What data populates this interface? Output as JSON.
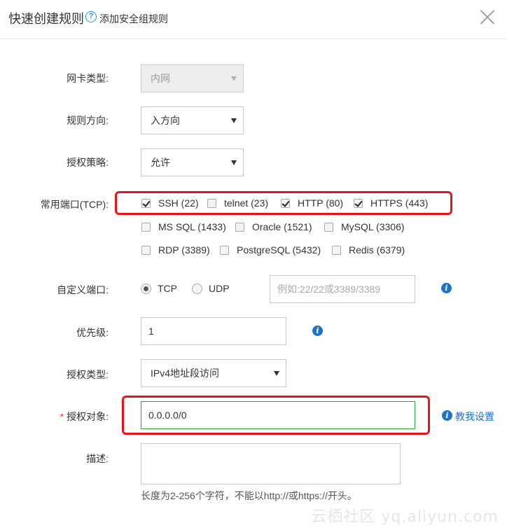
{
  "dialog": {
    "title": "快速创建规则",
    "help_icon": "?",
    "help_link": "添加安全组规则",
    "close_icon": "close-icon"
  },
  "form": {
    "nic_type": {
      "label": "网卡类型:",
      "value": "内网",
      "disabled": true
    },
    "direction": {
      "label": "规则方向:",
      "value": "入方向"
    },
    "policy": {
      "label": "授权策略:",
      "value": "允许"
    },
    "common_ports": {
      "label": "常用端口(TCP):",
      "options": [
        {
          "label": "SSH (22)",
          "checked": true
        },
        {
          "label": "telnet (23)",
          "checked": false
        },
        {
          "label": "HTTP (80)",
          "checked": true
        },
        {
          "label": "HTTPS (443)",
          "checked": true
        },
        {
          "label": "MS SQL (1433)",
          "checked": false
        },
        {
          "label": "Oracle (1521)",
          "checked": false
        },
        {
          "label": "MySQL (3306)",
          "checked": false
        },
        {
          "label": "RDP (3389)",
          "checked": false
        },
        {
          "label": "PostgreSQL (5432)",
          "checked": false
        },
        {
          "label": "Redis (6379)",
          "checked": false
        }
      ]
    },
    "custom_port": {
      "label": "自定义端口:",
      "protocols": [
        {
          "label": "TCP",
          "checked": true
        },
        {
          "label": "UDP",
          "checked": false
        }
      ],
      "value": "",
      "placeholder": "例如:22/22或3389/3389"
    },
    "priority": {
      "label": "优先级:",
      "value": "1"
    },
    "auth_type": {
      "label": "授权类型:",
      "value": "IPv4地址段访问"
    },
    "auth_object": {
      "label": "授权对象:",
      "required_mark": "*",
      "value": "0.0.0.0/0",
      "help_link": "教我设置"
    },
    "description": {
      "label": "描述:",
      "value": "",
      "hint": "长度为2-256个字符，不能以http://或https://开头。"
    }
  },
  "info_icon": "i",
  "watermark": "云栖社区 yq.aliyun.com",
  "colors": {
    "highlight": "#e8141c",
    "link": "#1e6fc8",
    "info": "#1e73c8",
    "valid_border": "#2da040"
  }
}
